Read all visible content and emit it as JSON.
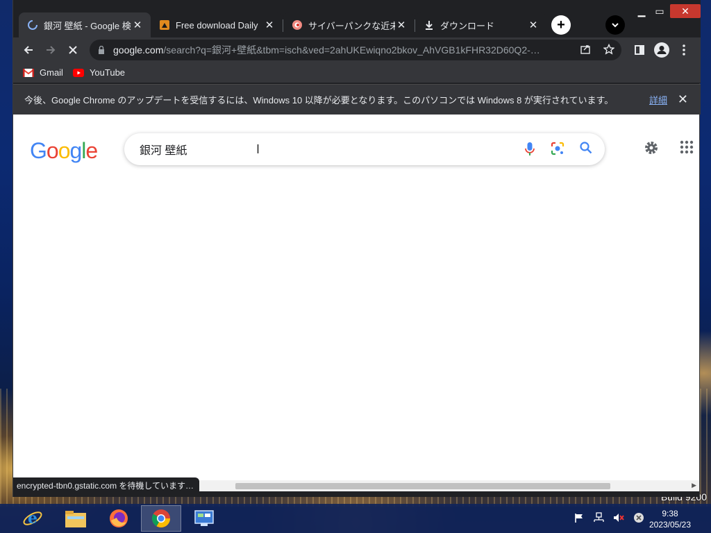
{
  "browser": {
    "tabs": [
      {
        "title": "銀河 壁紙 - Google 検索",
        "icon": "loading-spinner-icon",
        "active": true
      },
      {
        "title": "Free download Daily",
        "icon": "wallpaper-site-icon",
        "active": false
      },
      {
        "title": "サイバーパンクな近未来都市",
        "icon": "site-favicon-icon",
        "active": false
      },
      {
        "title": "ダウンロード",
        "icon": "download-icon",
        "active": false
      }
    ],
    "new_tab": "+",
    "url_host": "google.com",
    "url_path": "/search?q=銀河+壁紙&tbm=isch&ved=2ahUKEwiqno2bkov_AhVGB1kFHR32D60Q2-…",
    "bookmarks": [
      {
        "label": "Gmail",
        "icon": "gmail-icon"
      },
      {
        "label": "YouTube",
        "icon": "youtube-icon"
      }
    ],
    "infobar": {
      "message": "今後、Google Chrome のアップデートを受信するには、Windows 10 以降が必要となります。このパソコンでは Windows 8 が実行されています。",
      "link": "詳細"
    },
    "status": "encrypted-tbn0.gstatic.com を待機しています…"
  },
  "google": {
    "query": "銀河 壁紙",
    "logo_letters": [
      "G",
      "o",
      "o",
      "g",
      "l",
      "e"
    ],
    "logo_colors": [
      "#4285f4",
      "#ea4335",
      "#fbbc05",
      "#4285f4",
      "#34a853",
      "#ea4335"
    ]
  },
  "desktop": {
    "corner_text": "Build 9200"
  },
  "taskbar": {
    "time": "9:38",
    "date": "2023/05/23"
  }
}
